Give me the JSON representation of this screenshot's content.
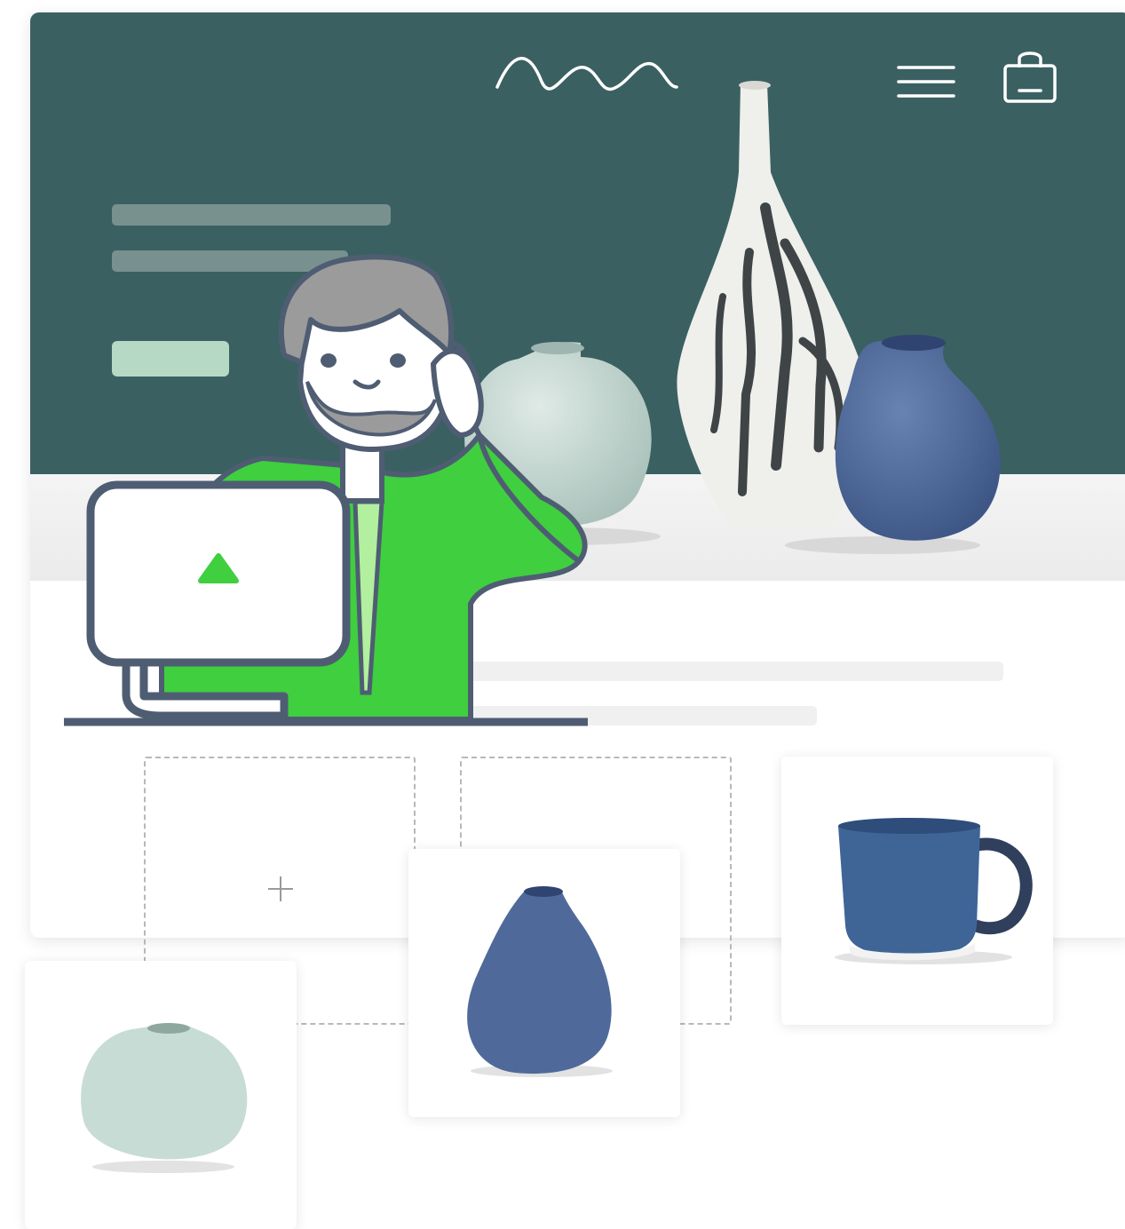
{
  "colors": {
    "hero_bg": "#3b6062",
    "placeholder_line": "#78918f",
    "cta": "#b5d9c4",
    "person_shirt": "#3fcf3f",
    "outline": "#4f5d73",
    "vase_blue": "#4f6a9a",
    "vase_mint": "#c8dcd6",
    "mug_blue": "#3f6597"
  },
  "header": {
    "logo_icon": "wave-logo-icon",
    "menu_icon": "hamburger-menu-icon",
    "cart_icon": "shopping-bag-icon"
  },
  "editor": {
    "add_slot_icon": "plus-icon"
  },
  "products": [
    {
      "icon": "blue-vase-image"
    },
    {
      "icon": "blue-mug-image"
    },
    {
      "icon": "mint-round-vase-image"
    }
  ],
  "illustration": {
    "person": "support-agent-illustration",
    "screen_icon": "triangle-logo-icon"
  }
}
